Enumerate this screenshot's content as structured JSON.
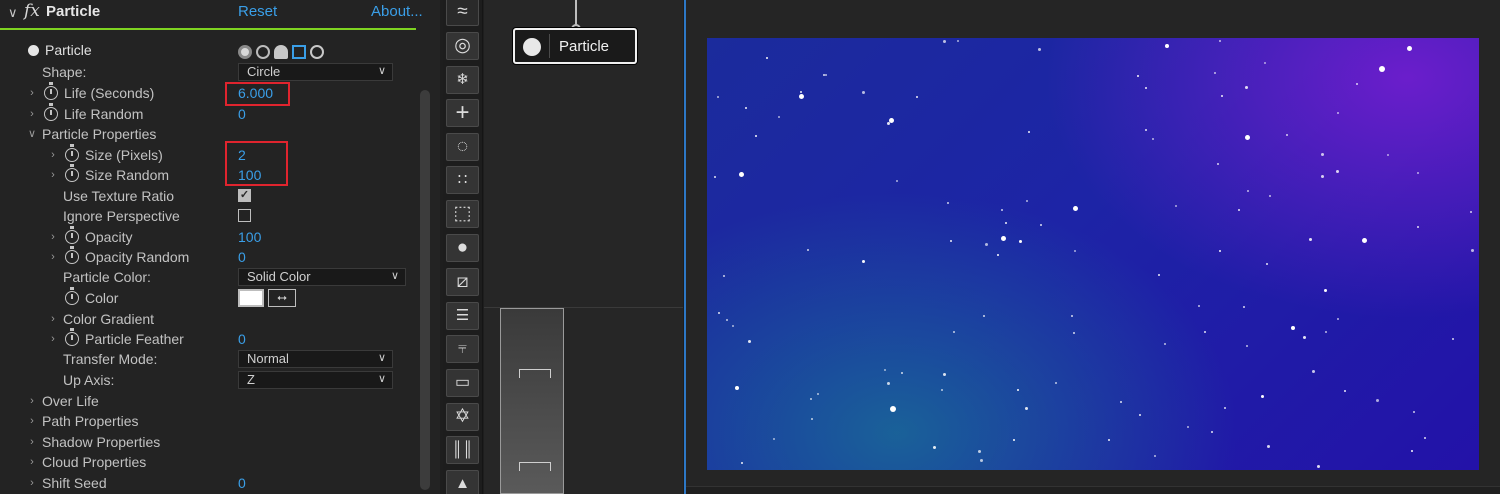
{
  "effect": {
    "name": "Particle",
    "reset_label": "Reset",
    "about_label": "About..."
  },
  "properties": {
    "particle_group": "Particle",
    "shape_label": "Shape:",
    "shape_value": "Circle",
    "life_label": "Life (Seconds)",
    "life_value": "6.000",
    "life_random_label": "Life Random",
    "life_random_value": "0",
    "particle_properties_label": "Particle Properties",
    "size_label": "Size (Pixels)",
    "size_value": "2",
    "size_random_label": "Size Random",
    "size_random_value": "100",
    "use_texture_ratio_label": "Use Texture Ratio",
    "use_texture_ratio_checked": true,
    "ignore_perspective_label": "Ignore Perspective",
    "ignore_perspective_checked": false,
    "opacity_label": "Opacity",
    "opacity_value": "100",
    "opacity_random_label": "Opacity Random",
    "opacity_random_value": "0",
    "particle_color_label": "Particle Color:",
    "particle_color_value": "Solid Color",
    "color_label": "Color",
    "color_value": "#ffffff",
    "color_gradient_label": "Color Gradient",
    "particle_feather_label": "Particle Feather",
    "particle_feather_value": "0",
    "transfer_mode_label": "Transfer Mode:",
    "transfer_mode_value": "Normal",
    "up_axis_label": "Up Axis:",
    "up_axis_value": "Z",
    "over_life_label": "Over Life",
    "path_properties_label": "Path Properties",
    "shadow_properties_label": "Shadow Properties",
    "cloud_properties_label": "Cloud Properties",
    "shift_seed_label": "Shift Seed",
    "shift_seed_value": "0"
  },
  "node_graph": {
    "node_label": "Particle"
  },
  "tools": [
    "waves-icon",
    "rings-icon",
    "snowflake-grid-icon",
    "plus-icon",
    "dotted-circle-icon",
    "four-circles-icon",
    "cube-icon",
    "sphere-icon",
    "hatched-square-icon",
    "panel-list-icon",
    "comb-icon",
    "rounded-rect-icon",
    "star-of-david-icon",
    "barcode-icon",
    "cone-icon"
  ],
  "colors": {
    "accent": "#3a9fe8",
    "effect_header_underline": "#7ed321",
    "highlight_box": "#e0242e",
    "viewer_border": "#2d78c6"
  }
}
